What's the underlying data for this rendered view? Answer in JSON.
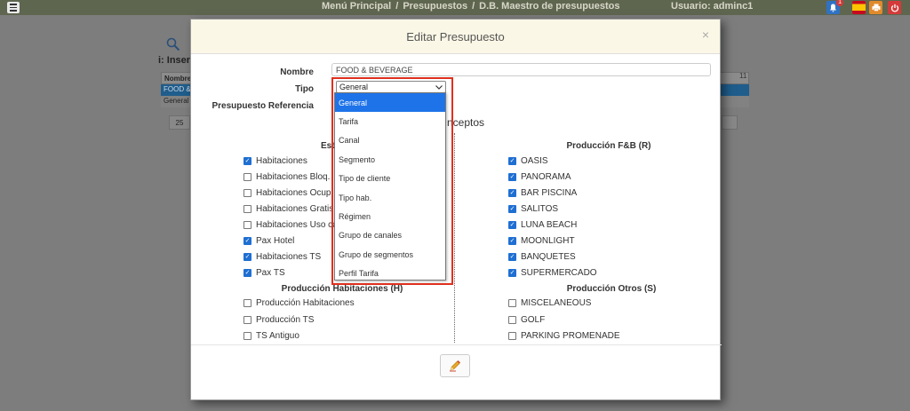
{
  "topbar": {
    "breadcrumb": [
      "Menú Principal",
      "Presupuestos",
      "D.B. Maestro de presupuestos"
    ],
    "separator": "/",
    "user": "Usuario: adminc1",
    "notification_count": "1",
    "icons": [
      "menu-icon",
      "bell-icon",
      "spain-flag-icon",
      "print-icon",
      "power-icon"
    ]
  },
  "background_page": {
    "insert_label": "i: Insert",
    "table_header": "Nombre",
    "rows": [
      "FOOD &",
      "General"
    ],
    "page_size": "25",
    "column_number": "11"
  },
  "modal": {
    "title": "Editar Presupuesto",
    "close": "×",
    "form": {
      "nombre_label": "Nombre",
      "nombre_value": "FOOD & BEVERAGE",
      "tipo_label": "Tipo",
      "tipo_value": "General",
      "pref_label": "Presupuesto Referencia"
    },
    "conceptos_label": "nceptos",
    "left_col_head_partial": "Est",
    "left_items": [
      {
        "label": "Habitaciones",
        "checked": true
      },
      {
        "label": "Habitaciones Bloq.",
        "checked": false
      },
      {
        "label": "Habitaciones Ocup.",
        "checked": false
      },
      {
        "label": "Habitaciones Gratis",
        "checked": false
      },
      {
        "label": "Habitaciones Uso ca",
        "checked": false
      },
      {
        "label": "Pax Hotel",
        "checked": true
      },
      {
        "label": "Habitaciones TS",
        "checked": true
      },
      {
        "label": "Pax TS",
        "checked": true
      }
    ],
    "prod_hab_title": "Producción Habitaciones (H)",
    "prod_hab_items": [
      {
        "label": "Producción Habitaciones",
        "checked": false
      },
      {
        "label": "Producción TS",
        "checked": false
      },
      {
        "label": "TS Antiguo",
        "checked": false
      }
    ],
    "fb_title": "Producción F&B (R)",
    "fb_items": [
      {
        "label": "OASIS",
        "checked": true
      },
      {
        "label": "PANORAMA",
        "checked": true
      },
      {
        "label": "BAR PISCINA",
        "checked": true
      },
      {
        "label": "SALITOS",
        "checked": true
      },
      {
        "label": "LUNA BEACH",
        "checked": true
      },
      {
        "label": "MOONLIGHT",
        "checked": true
      },
      {
        "label": "BANQUETES",
        "checked": true
      },
      {
        "label": "SUPERMERCADO",
        "checked": true
      }
    ],
    "otros_title": "Producción Otros (S)",
    "otros_items": [
      {
        "label": "MISCELANEOUS",
        "checked": false
      },
      {
        "label": "GOLF",
        "checked": false
      },
      {
        "label": "PARKING PROMENADE",
        "checked": false
      }
    ],
    "edit_button_icon": "pencil-icon"
  },
  "tipo_dropdown": {
    "options": [
      "General",
      "Tarifa",
      "Canal",
      "Segmento",
      "Tipo de cliente",
      "Tipo hab.",
      "Régimen",
      "Grupo de canales",
      "Grupo de segmentos",
      "Perfil Tarifa"
    ],
    "selected_index": 0,
    "highlight_color": "#e0301e"
  }
}
